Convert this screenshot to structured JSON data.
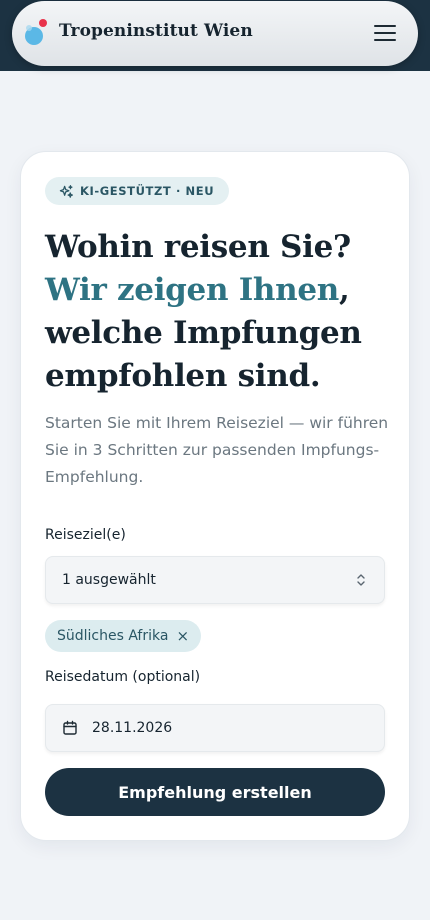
{
  "header": {
    "brand": "Tropeninstitut Wien",
    "menu_icon": "hamburger-menu-icon"
  },
  "hero": {
    "badge": "KI-GESTÜTZT · NEU",
    "badge_icon": "sparkles-icon",
    "headline_part1": "Wohin reisen Sie?",
    "headline_accent": "Wir zeigen Ihnen",
    "headline_comma": ",",
    "headline_part2": "welche Impfungen empfohlen sind.",
    "intro": "Starten Sie mit Ihrem Reiseziel — wir führen Sie in 3 Schritten zur passenden Impfungs-Empfehlung."
  },
  "form": {
    "destination_label": "Reiseziel(e)",
    "destination_value": "1 ausgewählt",
    "selected_chip": "Südliches Afrika",
    "chip_remove": "×",
    "date_label": "Reisedatum (optional)",
    "date_value": "28.11.2026",
    "submit_label": "Empfehlung erstellen"
  },
  "colors": {
    "navy": "#1c3242",
    "accent_teal": "#2e7383",
    "chip_bg": "#dcecef",
    "logo_blue": "#5bb8e6",
    "logo_red": "#e8324a"
  }
}
